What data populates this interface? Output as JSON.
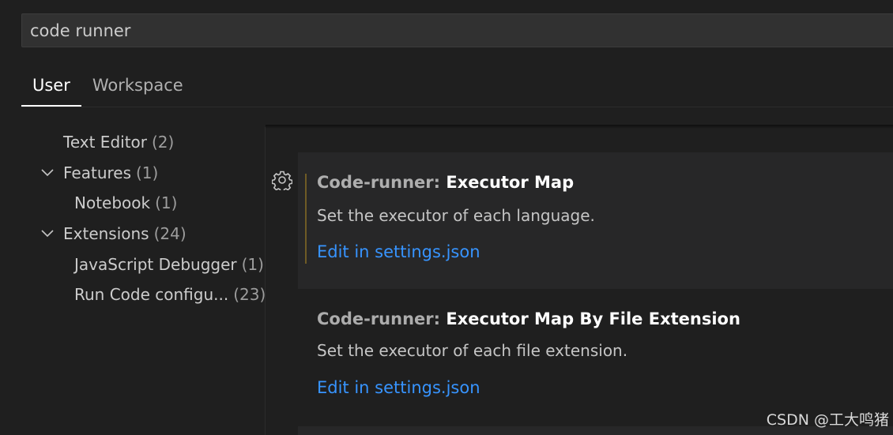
{
  "search": {
    "value": "code runner"
  },
  "tabs": [
    {
      "label": "User",
      "active": true
    },
    {
      "label": "Workspace",
      "active": false
    }
  ],
  "toc": [
    {
      "label": "Text Editor",
      "count": "(2)",
      "level": 0,
      "expandable": false
    },
    {
      "label": "Features",
      "count": "(1)",
      "level": 0,
      "expandable": true
    },
    {
      "label": "Notebook",
      "count": "(1)",
      "level": 1,
      "expandable": false
    },
    {
      "label": "Extensions",
      "count": "(24)",
      "level": 0,
      "expandable": true
    },
    {
      "label": "JavaScript Debugger",
      "count": "(1)",
      "level": 1,
      "expandable": false
    },
    {
      "label": "Run Code configu...",
      "count": "(23)",
      "level": 1,
      "expandable": false
    }
  ],
  "settings": [
    {
      "category": "Code-runner: ",
      "name": "Executor Map",
      "description": "Set the executor of each language.",
      "link": "Edit in settings.json"
    },
    {
      "category": "Code-runner: ",
      "name": "Executor Map By File Extension",
      "description": "Set the executor of each file extension.",
      "link": "Edit in settings.json"
    }
  ],
  "watermark": "CSDN @工大鸣猪",
  "icons": {
    "gear": "gear-icon",
    "chevron": "chevron-down-icon"
  },
  "colors": {
    "link": "#3794ff",
    "focus_bar": "#6f5b25",
    "background": "#1f1f1f"
  }
}
